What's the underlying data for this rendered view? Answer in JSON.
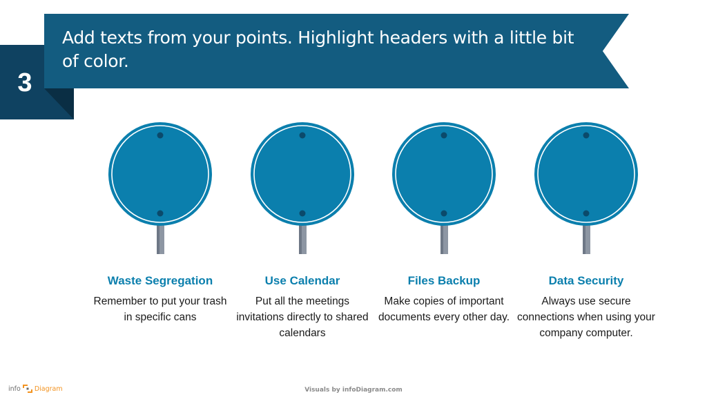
{
  "slide": {
    "step_number": "3",
    "title": "Add texts from your points. Highlight headers with a little bit of color.",
    "colors": {
      "banner": "#135c80",
      "number_box": "#0f4261",
      "sign": "#0b7fad",
      "header_text": "#0b7fad",
      "logo_accent": "#f39320"
    }
  },
  "items": [
    {
      "header": "Waste Segregation",
      "body": "Remember to put your trash in specific cans"
    },
    {
      "header": "Use Calendar",
      "body": "Put all the meetings invitations directly to shared calendars"
    },
    {
      "header": "Files Backup",
      "body": "Make copies of important documents every other day."
    },
    {
      "header": "Data Security",
      "body": "Always use secure connections when using your company computer."
    }
  ],
  "footer": {
    "logo_left": "info",
    "logo_right": "Diagram",
    "credit": "Visuals by infoDiagram.com"
  }
}
